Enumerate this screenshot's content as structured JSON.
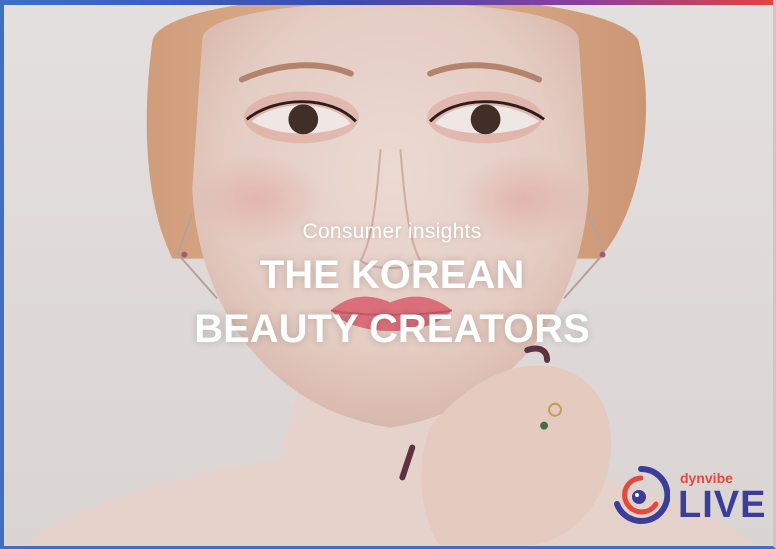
{
  "slide": {
    "subtitle": "Consumer insights",
    "title_line1": "THE KOREAN",
    "title_line2": "BEAUTY CREATORS"
  },
  "logo": {
    "brand": "dynvibe",
    "product": "LIVE",
    "colors": {
      "red": "#e5483f",
      "navy": "#3a3d9a"
    }
  },
  "accent_colors": {
    "frame_blue": "#3f6fc2",
    "bar_red": "#e2433f"
  }
}
